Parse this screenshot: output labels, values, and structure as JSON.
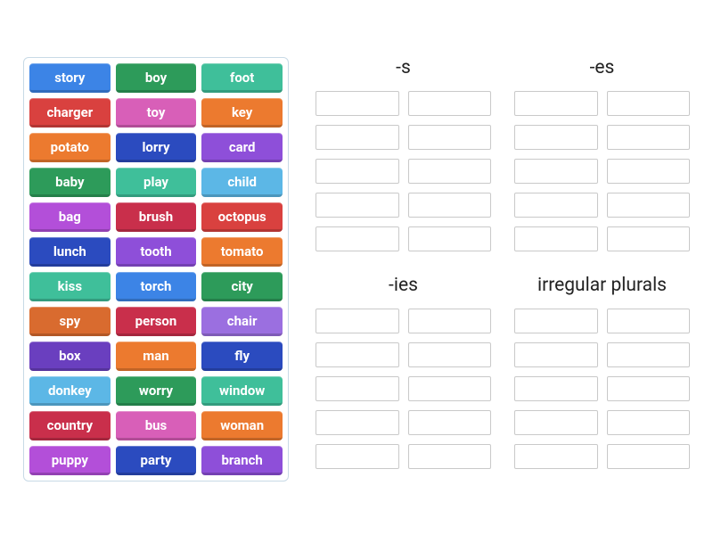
{
  "source_words": [
    {
      "label": "story",
      "color": "c-blue"
    },
    {
      "label": "boy",
      "color": "c-green"
    },
    {
      "label": "foot",
      "color": "c-teal"
    },
    {
      "label": "charger",
      "color": "c-red"
    },
    {
      "label": "toy",
      "color": "c-pink"
    },
    {
      "label": "key",
      "color": "c-orange"
    },
    {
      "label": "potato",
      "color": "c-orange"
    },
    {
      "label": "lorry",
      "color": "c-navy"
    },
    {
      "label": "card",
      "color": "c-purple"
    },
    {
      "label": "baby",
      "color": "c-green"
    },
    {
      "label": "play",
      "color": "c-teal"
    },
    {
      "label": "child",
      "color": "c-ltblue"
    },
    {
      "label": "bag",
      "color": "c-magenta"
    },
    {
      "label": "brush",
      "color": "c-crimson"
    },
    {
      "label": "octopus",
      "color": "c-red"
    },
    {
      "label": "lunch",
      "color": "c-navy"
    },
    {
      "label": "tooth",
      "color": "c-purple"
    },
    {
      "label": "tomato",
      "color": "c-orange"
    },
    {
      "label": "kiss",
      "color": "c-teal"
    },
    {
      "label": "torch",
      "color": "c-blue"
    },
    {
      "label": "city",
      "color": "c-green"
    },
    {
      "label": "spy",
      "color": "c-dkorange"
    },
    {
      "label": "person",
      "color": "c-crimson"
    },
    {
      "label": "chair",
      "color": "c-violet"
    },
    {
      "label": "box",
      "color": "c-dkpurp"
    },
    {
      "label": "man",
      "color": "c-orange"
    },
    {
      "label": "fly",
      "color": "c-navy"
    },
    {
      "label": "donkey",
      "color": "c-ltblue"
    },
    {
      "label": "worry",
      "color": "c-green"
    },
    {
      "label": "window",
      "color": "c-teal"
    },
    {
      "label": "country",
      "color": "c-crimson"
    },
    {
      "label": "bus",
      "color": "c-pink"
    },
    {
      "label": "woman",
      "color": "c-orange"
    },
    {
      "label": "puppy",
      "color": "c-magenta"
    },
    {
      "label": "party",
      "color": "c-navy"
    },
    {
      "label": "branch",
      "color": "c-purple"
    }
  ],
  "categories": [
    {
      "title": "-s",
      "slot_count": 10
    },
    {
      "title": "-es",
      "slot_count": 10
    },
    {
      "title": "-ies",
      "slot_count": 10
    },
    {
      "title": "irregular plurals",
      "slot_count": 10
    }
  ]
}
